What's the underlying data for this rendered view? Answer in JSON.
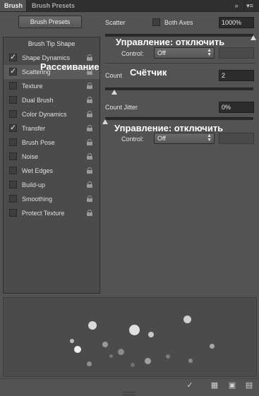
{
  "tabs": [
    "Brush",
    "Brush Presets"
  ],
  "brush_presets_button": "Brush Presets",
  "brush_tip_shape": "Brush Tip Shape",
  "options": [
    {
      "label": "Shape Dynamics",
      "checked": true,
      "selected": false
    },
    {
      "label": "Scattering",
      "checked": true,
      "selected": true
    },
    {
      "label": "Texture",
      "checked": false,
      "selected": false
    },
    {
      "label": "Dual Brush",
      "checked": false,
      "selected": false
    },
    {
      "label": "Color Dynamics",
      "checked": false,
      "selected": false
    },
    {
      "label": "Transfer",
      "checked": true,
      "selected": false
    },
    {
      "label": "Brush Pose",
      "checked": false,
      "selected": false
    },
    {
      "label": "Noise",
      "checked": false,
      "selected": false
    },
    {
      "label": "Wet Edges",
      "checked": false,
      "selected": false
    },
    {
      "label": "Build-up",
      "checked": false,
      "selected": false
    },
    {
      "label": "Smoothing",
      "checked": false,
      "selected": false
    },
    {
      "label": "Protect Texture",
      "checked": false,
      "selected": false
    }
  ],
  "scatter": {
    "label": "Scatter",
    "both_axes_label": "Both Axes",
    "both_axes_checked": false,
    "value": "1000%",
    "slider_fraction": 1.0,
    "control_label": "Control:",
    "control_value": "Off"
  },
  "count": {
    "label": "Count",
    "value": "2",
    "slider_fraction": 0.06
  },
  "count_jitter": {
    "label": "Count Jitter",
    "value": "0%",
    "slider_fraction": 0.0,
    "control_label": "Control:",
    "control_value": "Off"
  },
  "captions": {
    "control_off_1": "Управление: отключить",
    "scattering_ru": "Рассеивание",
    "count_ru": "Счётчик",
    "control_off_2": "Управление: отключить"
  },
  "colors": {
    "panel_bg": "#535353",
    "field_bg": "#2c2c2c",
    "caption_text": "#ffffff"
  }
}
